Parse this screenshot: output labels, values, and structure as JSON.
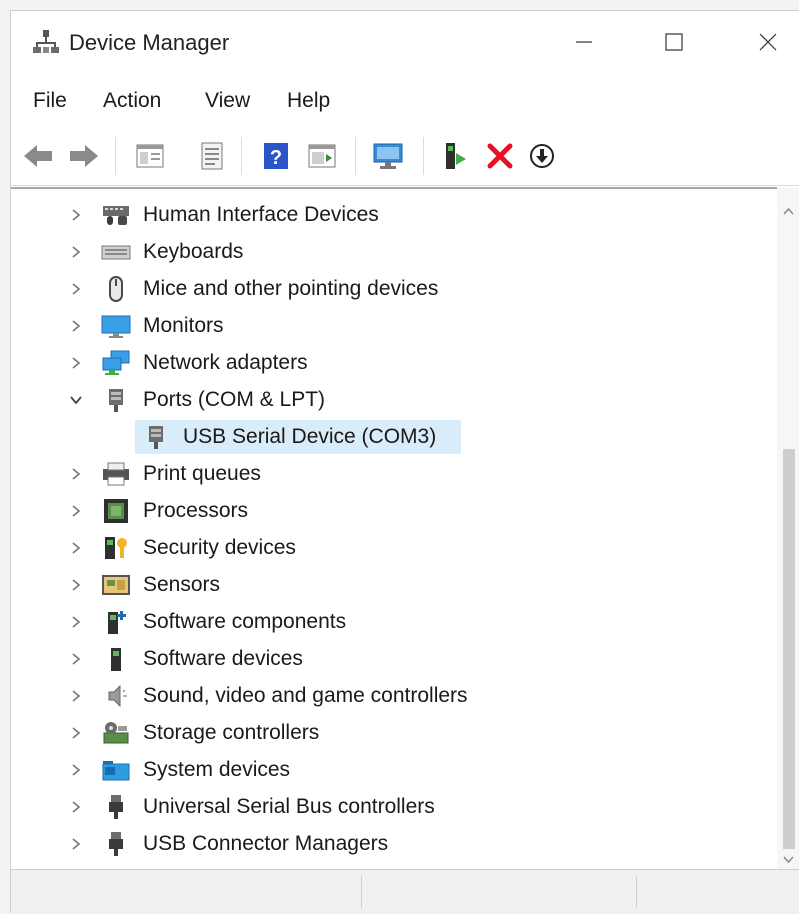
{
  "window": {
    "title": "Device Manager"
  },
  "menu": [
    "File",
    "Action",
    "View",
    "Help"
  ],
  "toolbar": {
    "buttons": [
      "back",
      "forward",
      "show-hide-console-tree",
      "properties",
      "help",
      "action-pane",
      "scan-for-hardware-changes",
      "update-driver",
      "uninstall-device",
      "disable-device"
    ]
  },
  "tree": {
    "items": [
      {
        "label": "Human Interface Devices",
        "icon": "hid-icon",
        "expanded": false
      },
      {
        "label": "Keyboards",
        "icon": "keyboard-icon",
        "expanded": false
      },
      {
        "label": "Mice and other pointing devices",
        "icon": "mouse-icon",
        "expanded": false
      },
      {
        "label": "Monitors",
        "icon": "monitor-icon",
        "expanded": false
      },
      {
        "label": "Network adapters",
        "icon": "network-adapter-icon",
        "expanded": false
      },
      {
        "label": "Ports (COM & LPT)",
        "icon": "port-icon",
        "expanded": true
      },
      {
        "label": "USB Serial Device (COM3)",
        "icon": "usb-serial-icon",
        "child": true,
        "selected": true
      },
      {
        "label": "Print queues",
        "icon": "printer-icon",
        "expanded": false
      },
      {
        "label": "Processors",
        "icon": "processor-icon",
        "expanded": false
      },
      {
        "label": "Security devices",
        "icon": "security-device-icon",
        "expanded": false
      },
      {
        "label": "Sensors",
        "icon": "sensor-icon",
        "expanded": false
      },
      {
        "label": "Software components",
        "icon": "software-component-icon",
        "expanded": false
      },
      {
        "label": "Software devices",
        "icon": "software-device-icon",
        "expanded": false
      },
      {
        "label": "Sound, video and game controllers",
        "icon": "sound-icon",
        "expanded": false
      },
      {
        "label": "Storage controllers",
        "icon": "storage-controller-icon",
        "expanded": false
      },
      {
        "label": "System devices",
        "icon": "system-device-icon",
        "expanded": false
      },
      {
        "label": "Universal Serial Bus controllers",
        "icon": "usb-controller-icon",
        "expanded": false
      },
      {
        "label": "USB Connector Managers",
        "icon": "usb-connector-icon",
        "expanded": false
      }
    ]
  },
  "colors": {
    "selection": "#d9ecf9",
    "accent": "#0078d7",
    "uninstall_red": "#e81123"
  }
}
